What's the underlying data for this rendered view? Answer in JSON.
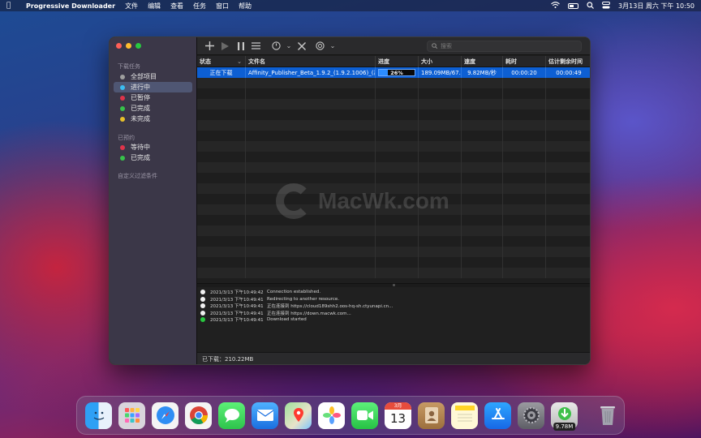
{
  "menubar": {
    "app_name": "Progressive Downloader",
    "menus": [
      "文件",
      "编辑",
      "查看",
      "任务",
      "窗口",
      "帮助"
    ],
    "clock": "3月13日 周六 下午 10:50"
  },
  "sidebar": {
    "section_tasks": "下载任务",
    "tasks": [
      {
        "label": "全部项目",
        "color": "#9e9e9e"
      },
      {
        "label": "进行中",
        "color": "#3bbcf0"
      },
      {
        "label": "已暂停",
        "color": "#e0344a"
      },
      {
        "label": "已完成",
        "color": "#37c24a"
      },
      {
        "label": "未完成",
        "color": "#e6c02a"
      }
    ],
    "section_scheduled": "已预约",
    "scheduled": [
      {
        "label": "等待中",
        "color": "#e0344a"
      },
      {
        "label": "已完成",
        "color": "#37c24a"
      }
    ],
    "section_custom": "自定义过滤条件"
  },
  "toolbar": {
    "search_placeholder": "搜索"
  },
  "table": {
    "columns": [
      "状态",
      "文件名",
      "进度",
      "大小",
      "速度",
      "耗时",
      "估计剩余时间"
    ],
    "rows": [
      {
        "status": "正在下载",
        "filename": "Affinity_Publisher_Beta_1.9.2_(1.9.2.1006)_(暴...",
        "progress": 26,
        "progress_label": "26%",
        "size": "189.09MB/67...",
        "speed": "9.82MB/秒",
        "elapsed": "00:00:20",
        "remaining": "00:00:49"
      }
    ]
  },
  "log": [
    {
      "time": "2021/3/13 下午10:49:42",
      "message": "Connection established.",
      "color": "white"
    },
    {
      "time": "2021/3/13 下午10:49:41",
      "message": "Redirecting to another resource.",
      "color": "white"
    },
    {
      "time": "2021/3/13 下午10:49:41",
      "message": "正在连接到 https://cloud189shh2.oos-hq-sh.ctyunapi.cn...",
      "color": "white"
    },
    {
      "time": "2021/3/13 下午10:49:41",
      "message": "正在连接到 https://down.macwk.com...",
      "color": "white"
    },
    {
      "time": "2021/3/13 下午10:49:41",
      "message": "Download started",
      "color": "green"
    }
  ],
  "status": {
    "downloaded": "已下载：210.22MB"
  },
  "watermark": "MacWk.com",
  "dock": {
    "calendar_month": "3月",
    "calendar_day": "13",
    "downloader_badge": "9.78M"
  }
}
